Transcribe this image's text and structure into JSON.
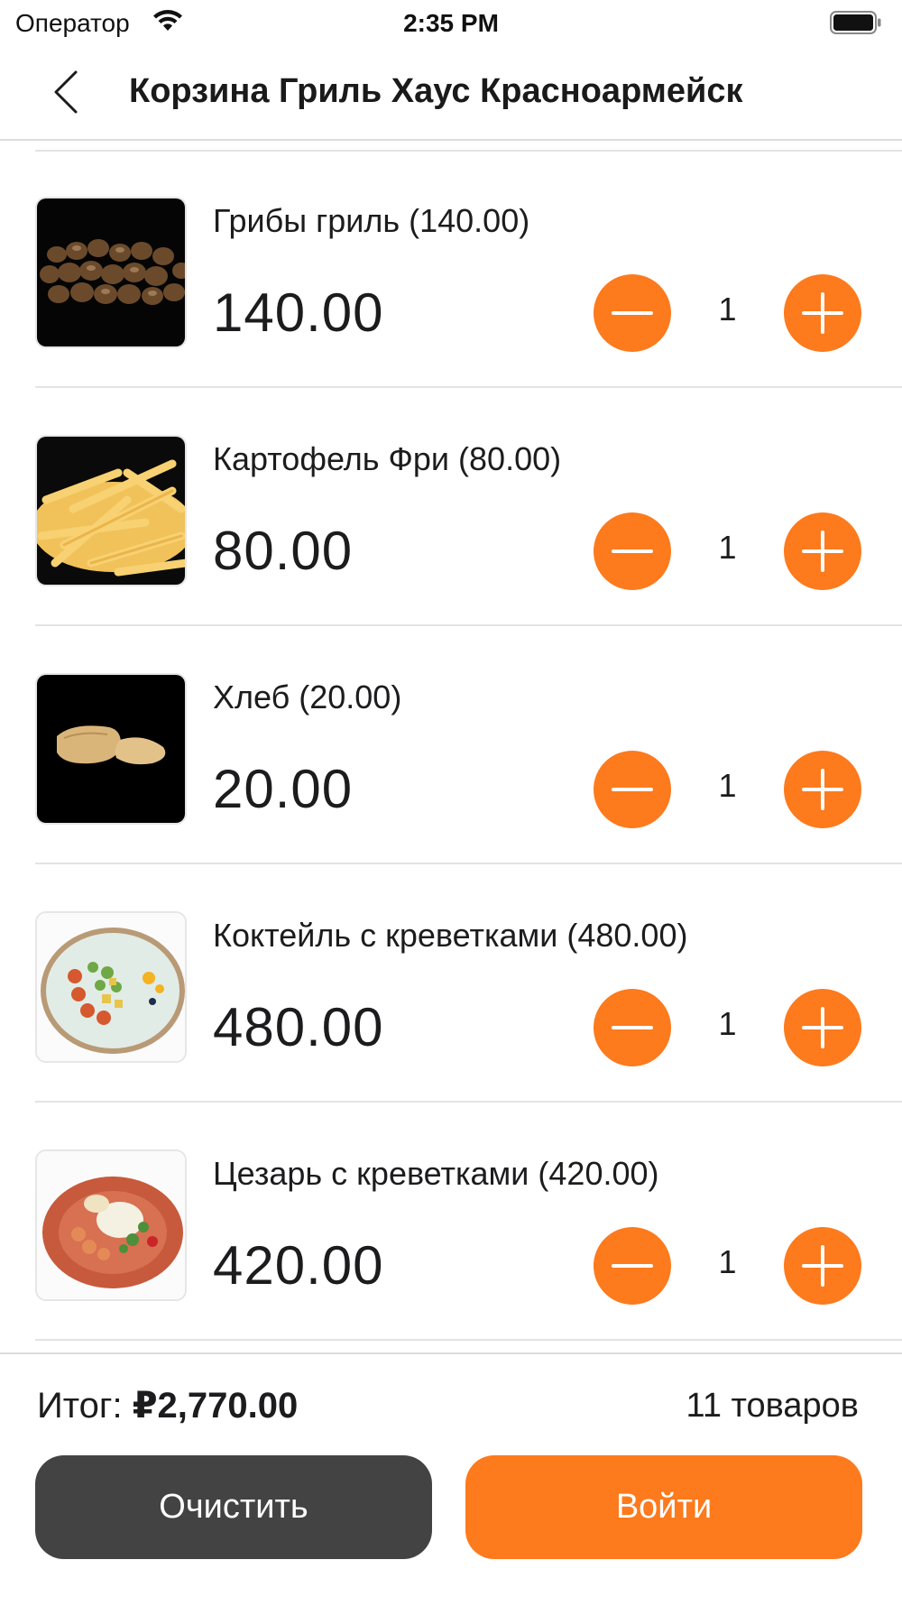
{
  "status_bar": {
    "carrier": "Оператор",
    "time": "2:35 PM"
  },
  "nav": {
    "title": "Корзина Гриль Хаус Красноармейск",
    "back_icon": "chevron-left-icon"
  },
  "colors": {
    "accent": "#fd7a1d",
    "dark_button": "#434343"
  },
  "cart": {
    "items": [
      {
        "name": "Грибы гриль (140.00)",
        "price": "140.00",
        "qty": "1",
        "image": "grilled-mushrooms"
      },
      {
        "name": "Картофель Фри (80.00)",
        "price": "80.00",
        "qty": "1",
        "image": "french-fries"
      },
      {
        "name": "Хлеб (20.00)",
        "price": "20.00",
        "qty": "1",
        "image": "bread"
      },
      {
        "name": "Коктейль с креветками (480.00)",
        "price": "480.00",
        "qty": "1",
        "image": "shrimp-cocktail-plate"
      },
      {
        "name": "Цезарь с креветками (420.00)",
        "price": "420.00",
        "qty": "1",
        "image": "caesar-shrimp-plate"
      }
    ]
  },
  "footer": {
    "total_label": "Итог: ",
    "total_value": "₽2,770.00",
    "items_count": "11 товаров",
    "clear_label": "Очистить",
    "login_label": "Войти"
  }
}
